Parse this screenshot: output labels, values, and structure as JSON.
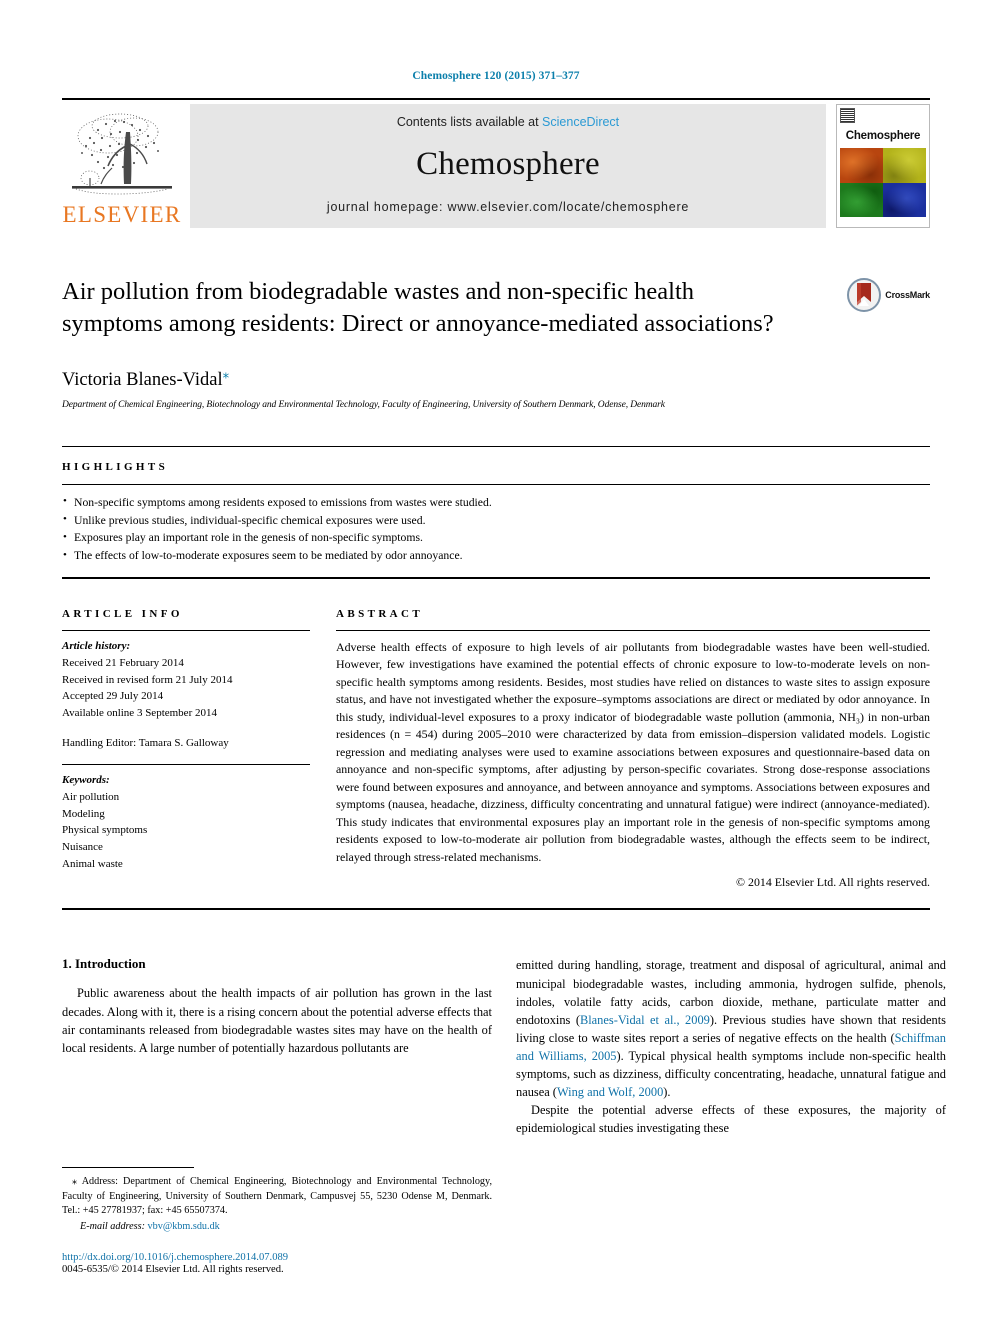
{
  "masthead": {
    "citation": "Chemosphere 120 (2015) 371–377",
    "contents_prefix": "Contents lists available at ",
    "contents_link": "ScienceDirect",
    "journal_name": "Chemosphere",
    "homepage": "journal homepage: www.elsevier.com/locate/chemosphere",
    "publisher_name": "ELSEVIER",
    "cover_title": "Chemosphere"
  },
  "article": {
    "title": "Air pollution from biodegradable wastes and non-specific health symptoms among residents: Direct or annoyance-mediated associations?",
    "crossmark_label": "CrossMark",
    "author": "Victoria Blanes-Vidal",
    "author_marker": "⁎",
    "affiliation": "Department of Chemical Engineering, Biotechnology and Environmental Technology, Faculty of Engineering, University of Southern Denmark, Odense, Denmark"
  },
  "highlights": {
    "label": "HIGHLIGHTS",
    "items": [
      "Non-specific symptoms among residents exposed to emissions from wastes were studied.",
      "Unlike previous studies, individual-specific chemical exposures were used.",
      "Exposures play an important role in the genesis of non-specific symptoms.",
      "The effects of low-to-moderate exposures seem to be mediated by odor annoyance."
    ]
  },
  "article_info": {
    "label": "ARTICLE INFO",
    "history_heading": "Article history:",
    "history": [
      "Received 21 February 2014",
      "Received in revised form 21 July 2014",
      "Accepted 29 July 2014",
      "Available online 3 September 2014"
    ],
    "handling_editor": "Handling Editor: Tamara S. Galloway",
    "keywords_heading": "Keywords:",
    "keywords": [
      "Air pollution",
      "Modeling",
      "Physical symptoms",
      "Nuisance",
      "Animal waste"
    ]
  },
  "abstract": {
    "label": "ABSTRACT",
    "text": "Adverse health effects of exposure to high levels of air pollutants from biodegradable wastes have been well-studied. However, few investigations have examined the potential effects of chronic exposure to low-to-moderate levels on non-specific health symptoms among residents. Besides, most studies have relied on distances to waste sites to assign exposure status, and have not investigated whether the exposure–symptoms associations are direct or mediated by odor annoyance. In this study, individual-level exposures to a proxy indicator of biodegradable waste pollution (ammonia, NH₃) in non-urban residences (n = 454) during 2005–2010 were characterized by data from emission–dispersion validated models. Logistic regression and mediating analyses were used to examine associations between exposures and questionnaire-based data on annoyance and non-specific symptoms, after adjusting by person-specific covariates. Strong dose-response associations were found between exposures and annoyance, and between annoyance and symptoms. Associations between exposures and symptoms (nausea, headache, dizziness, difficulty concentrating and unnatural fatigue) were indirect (annoyance-mediated). This study indicates that environmental exposures play an important role in the genesis of non-specific symptoms among residents exposed to low-to-moderate air pollution from biodegradable wastes, although the effects seem to be indirect, relayed through stress-related mechanisms.",
    "copyright": "© 2014 Elsevier Ltd. All rights reserved."
  },
  "body": {
    "section_heading": "1. Introduction",
    "left_paragraph": "Public awareness about the health impacts of air pollution has grown in the last decades. Along with it, there is a rising concern about the potential adverse effects that air contaminants released from biodegradable wastes sites may have on the health of local residents. A large number of potentially hazardous pollutants are",
    "right_paragraph_1a": "emitted during handling, storage, treatment and disposal of agricultural, animal and municipal biodegradable wastes, including ammonia, hydrogen sulfide, phenols, indoles, volatile fatty acids, carbon dioxide, methane, particulate matter and endotoxins (",
    "right_ref_1": "Blanes-Vidal et al., 2009",
    "right_paragraph_1b": "). Previous studies have shown that residents living close to waste sites report a series of negative effects on the health (",
    "right_ref_2": "Schiffman and Williams, 2005",
    "right_paragraph_1c": "). Typical physical health symptoms include non-specific health symptoms, such as dizziness, difficulty concentrating, headache, unnatural fatigue and nausea (",
    "right_ref_3": "Wing and Wolf, 2000",
    "right_paragraph_1d": ").",
    "right_paragraph_2": "Despite the potential adverse effects of these exposures, the majority of epidemiological studies investigating these"
  },
  "footnotes": {
    "address_marker": "⁎",
    "address": "Address: Department of Chemical Engineering, Biotechnology and Environmental Technology, Faculty of Engineering, University of Southern Denmark, Campusvej 55, 5230 Odense M, Denmark. Tel.: +45 27781937; fax: +45 65507374.",
    "email_label": "E-mail address:",
    "email": "vbv@kbm.sdu.dk",
    "doi": "http://dx.doi.org/10.1016/j.chemosphere.2014.07.089",
    "issn": "0045-6535/© 2014 Elsevier Ltd. All rights reserved."
  },
  "colors": {
    "link": "#1072a8",
    "masthead_cite": "#0b7fab",
    "elsevier_orange": "#e87722",
    "sciencedirect": "#2b9ad4",
    "band_gray": "#e6e6e6"
  }
}
